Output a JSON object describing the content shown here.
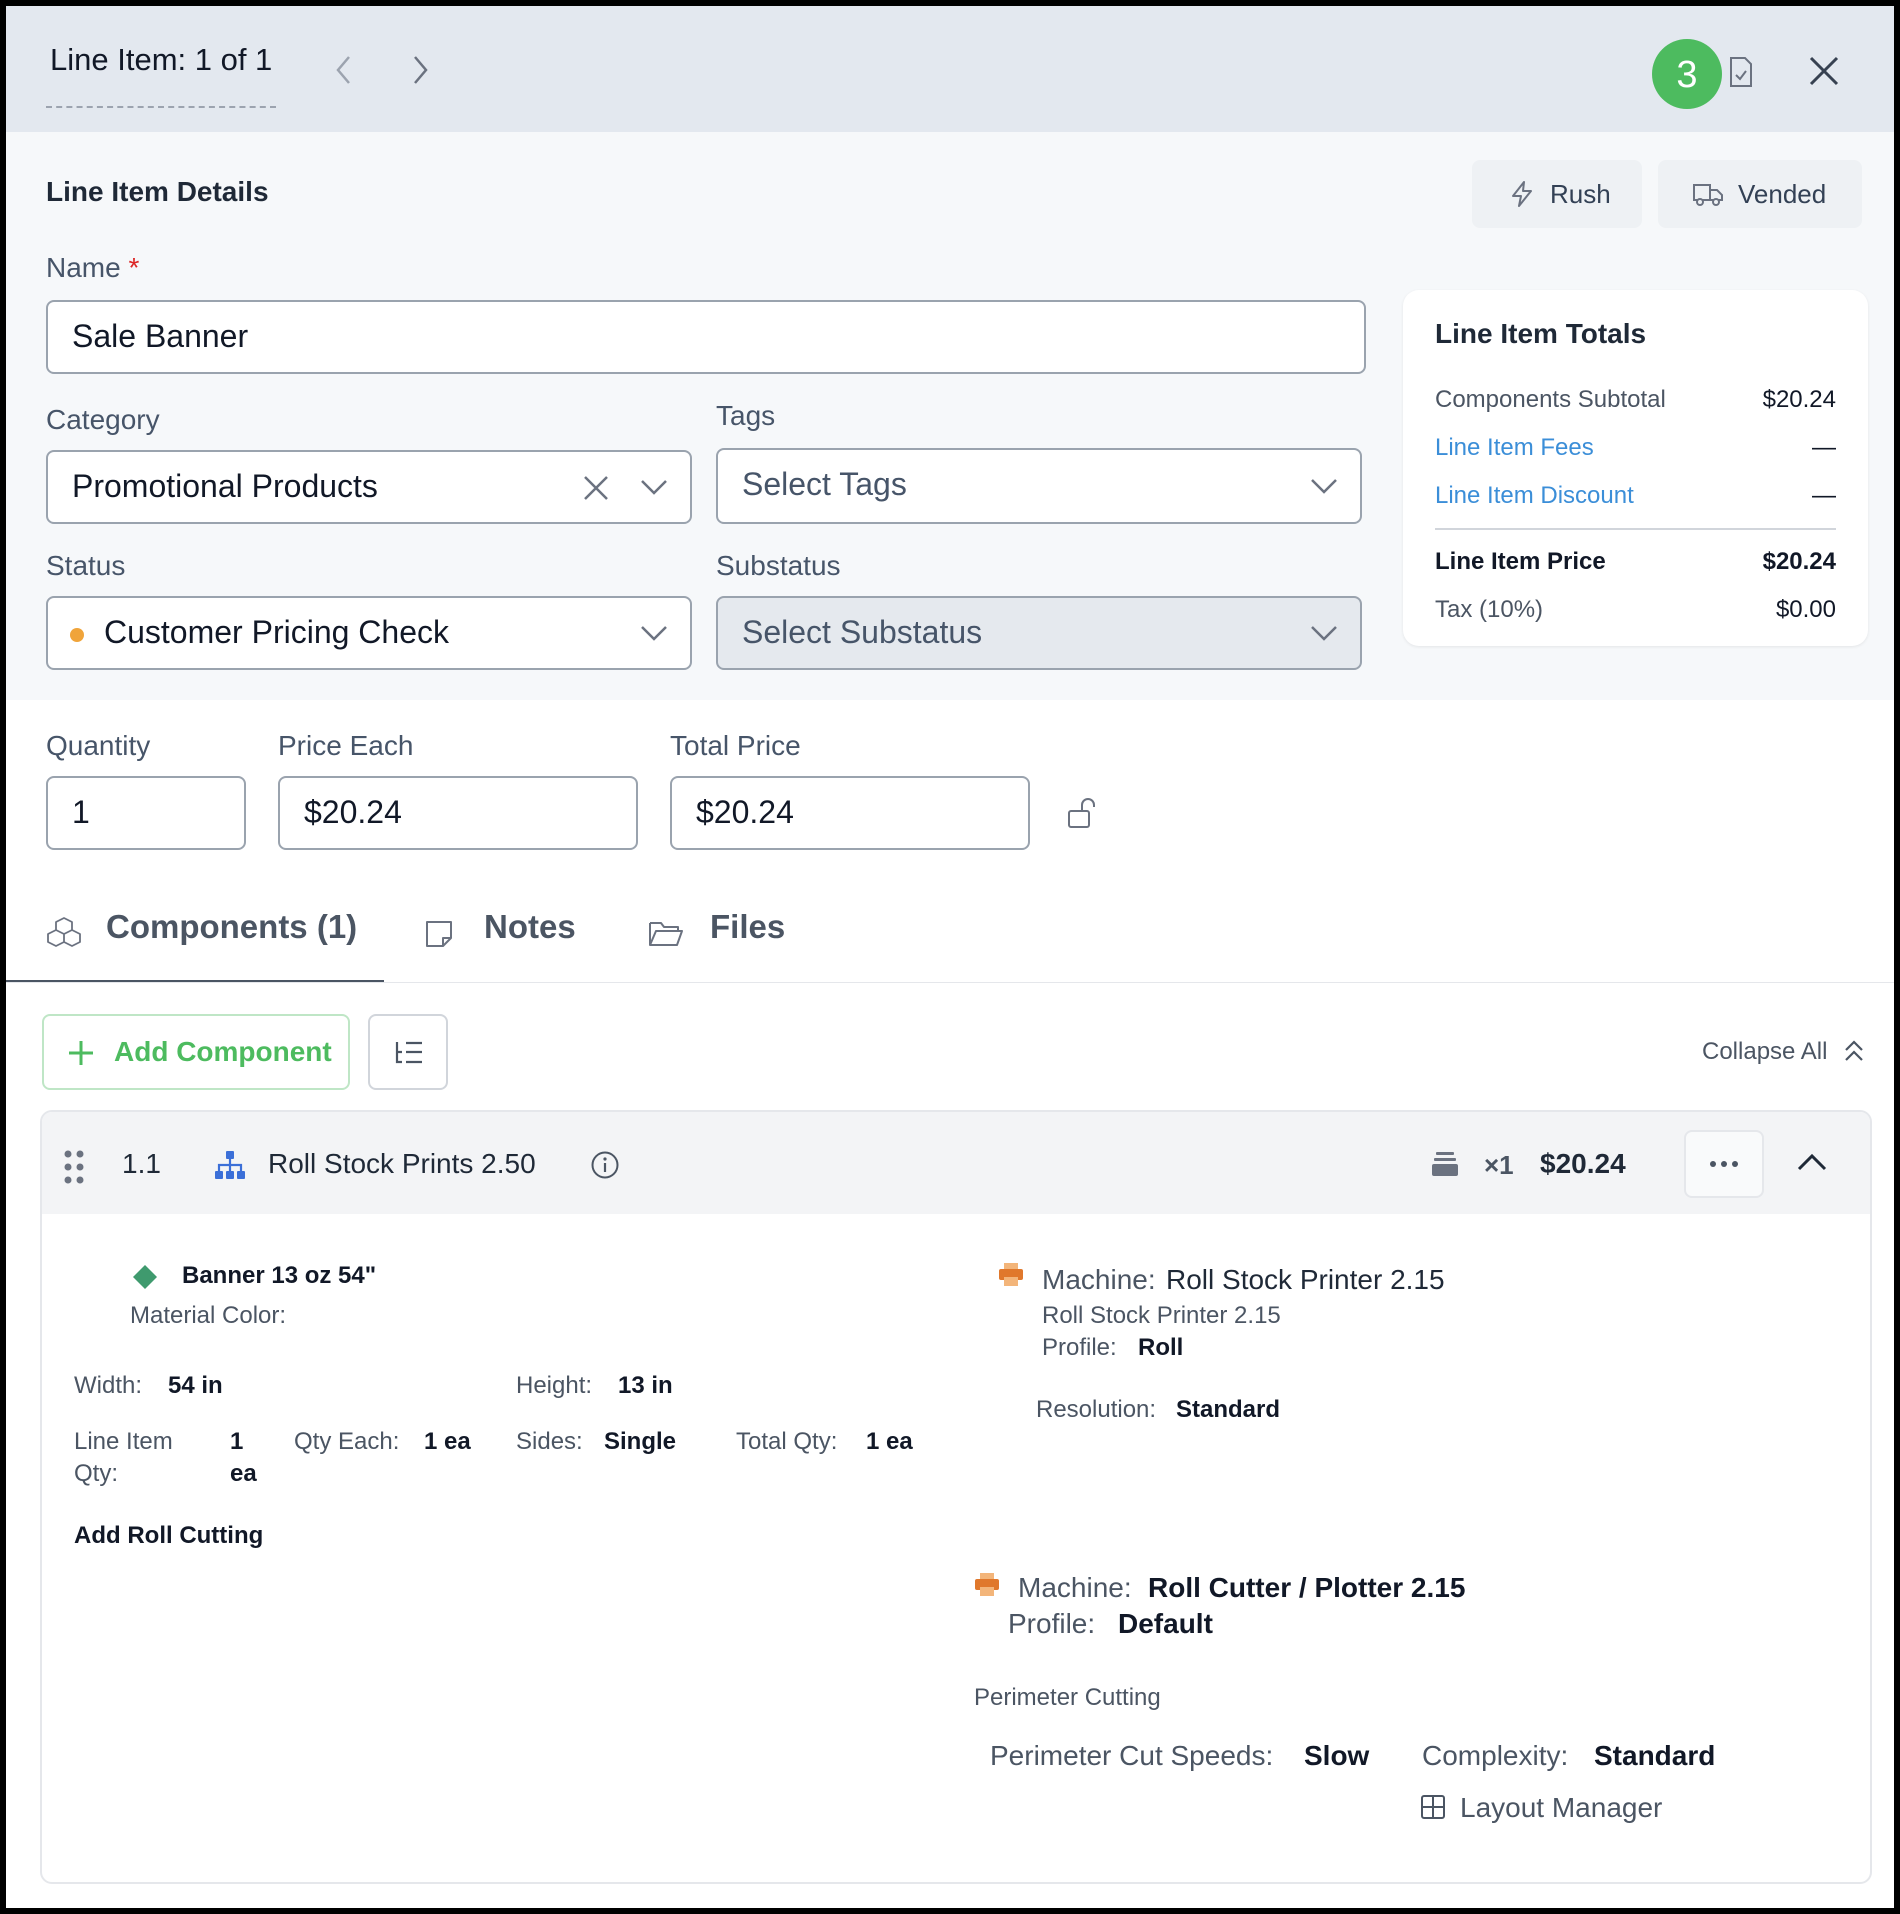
{
  "header": {
    "title": "Line Item: 1 of 1",
    "badge_count": "3"
  },
  "details": {
    "section_title": "Line Item Details",
    "rush_label": "Rush",
    "vended_label": "Vended",
    "name_label": "Name",
    "required_mark": "*",
    "name_value": "Sale Banner",
    "category_label": "Category",
    "category_value": "Promotional Products",
    "tags_label": "Tags",
    "tags_placeholder": "Select Tags",
    "status_label": "Status",
    "status_value": "Customer Pricing Check",
    "status_color": "#f0a43a",
    "substatus_label": "Substatus",
    "substatus_placeholder": "Select Substatus"
  },
  "totals": {
    "title": "Line Item Totals",
    "rows": [
      {
        "label": "Components Subtotal",
        "value": "$20.24"
      },
      {
        "label": "Line Item Fees",
        "value": "—"
      },
      {
        "label": "Line Item Discount",
        "value": "—"
      },
      {
        "label": "Line Item Price",
        "value": "$20.24"
      },
      {
        "label": "Tax (10%)",
        "value": "$0.00"
      }
    ]
  },
  "pricing": {
    "quantity_label": "Quantity",
    "quantity_value": "1",
    "price_each_label": "Price Each",
    "price_each_value": "$20.24",
    "total_price_label": "Total Price",
    "total_price_value": "$20.24"
  },
  "tabs": [
    {
      "label": "Components (1)"
    },
    {
      "label": "Notes"
    },
    {
      "label": "Files"
    }
  ],
  "toolbar": {
    "add_component": "Add Component",
    "collapse_all": "Collapse All"
  },
  "component": {
    "number": "1.1",
    "name": "Roll Stock Prints 2.50",
    "qty": "×1",
    "price": "$20.24",
    "material_name": "Banner 13 oz 54\"",
    "material_color_label": "Material Color:",
    "width_label": "Width:",
    "width_value": "54 in",
    "height_label": "Height:",
    "height_value": "13 in",
    "line_qty_label_1": "Line Item",
    "line_qty_label_2": "Qty:",
    "line_qty_value_1": "1",
    "line_qty_value_2": "ea",
    "qty_each_label": "Qty Each:",
    "qty_each_value": "1 ea",
    "sides_label": "Sides:",
    "sides_value": "Single",
    "total_qty_label": "Total Qty:",
    "total_qty_value": "1 ea",
    "add_roll_cutting": "Add Roll Cutting",
    "machine1_label": "Machine:",
    "machine1_name": "Roll Stock Printer 2.15",
    "machine1_sub": "Roll Stock Printer 2.15",
    "profile1_label": "Profile:",
    "profile1_value": "Roll",
    "resolution_label": "Resolution:",
    "resolution_value": "Standard",
    "machine2_label": "Machine:",
    "machine2_name": "Roll Cutter / Plotter 2.15",
    "profile2_label": "Profile:",
    "profile2_value": "Default",
    "perimeter_title": "Perimeter Cutting",
    "cut_speed_label": "Perimeter Cut Speeds:",
    "cut_speed_value": "Slow",
    "complexity_label": "Complexity:",
    "complexity_value": "Standard",
    "layout_manager": "Layout Manager"
  }
}
